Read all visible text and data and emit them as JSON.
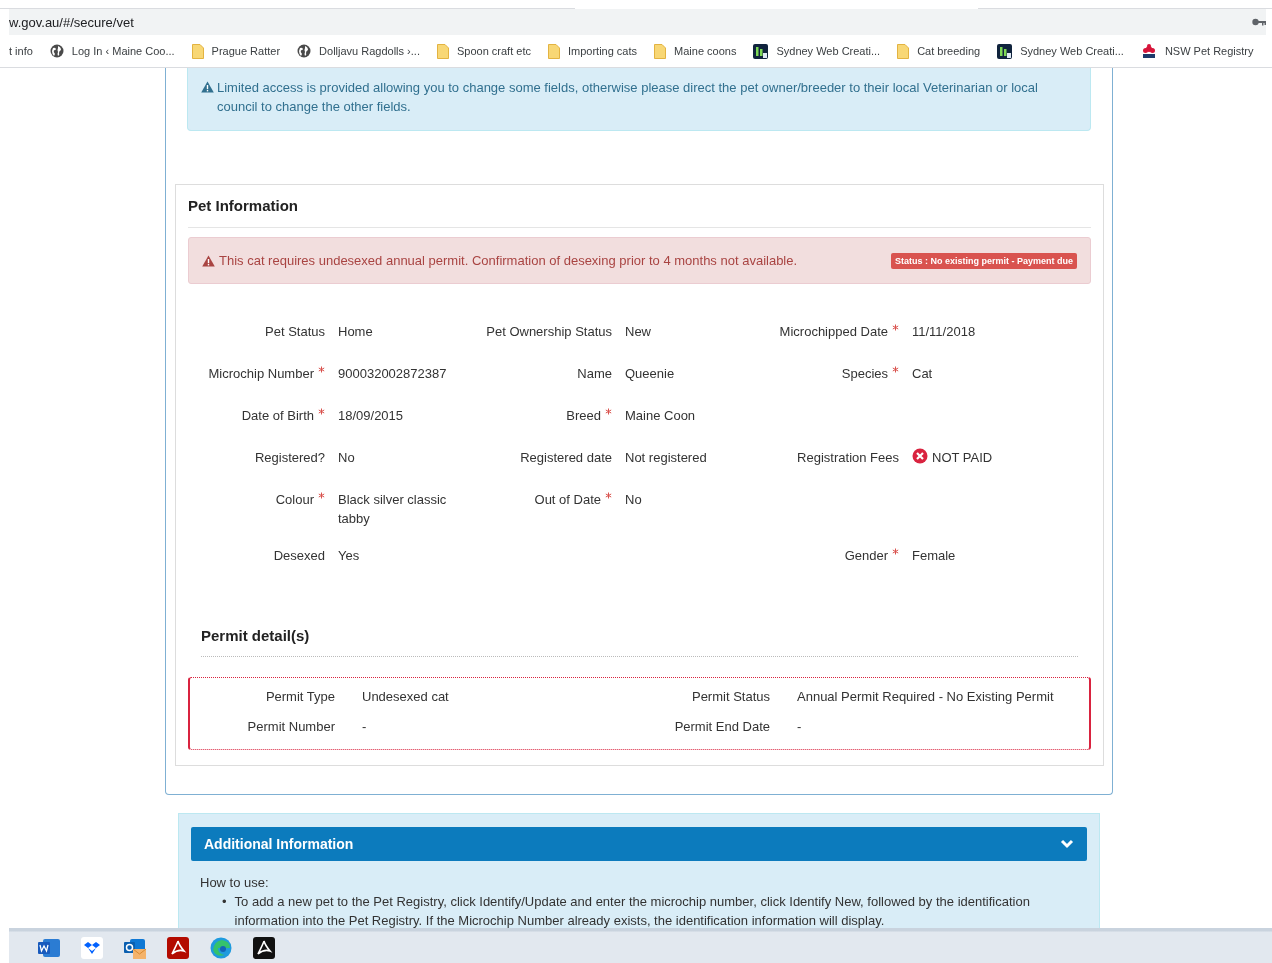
{
  "browser": {
    "url": "w.gov.au/#/secure/vet",
    "bookmarks": [
      {
        "label": "t info",
        "kind": "plain"
      },
      {
        "label": "Log In ‹ Maine Coo...",
        "kind": "site"
      },
      {
        "label": "Prague Ratter",
        "kind": "folder"
      },
      {
        "label": "Dolljavu Ragdolls ›...",
        "kind": "site"
      },
      {
        "label": "Spoon craft etc",
        "kind": "folder"
      },
      {
        "label": "Importing cats",
        "kind": "folder"
      },
      {
        "label": "Maine coons",
        "kind": "folder"
      },
      {
        "label": "Sydney Web Creati...",
        "kind": "app"
      },
      {
        "label": "Cat breeding",
        "kind": "folder"
      },
      {
        "label": "Sydney Web Creati...",
        "kind": "app"
      },
      {
        "label": "NSW Pet Registry",
        "kind": "registry"
      }
    ]
  },
  "notice": {
    "message": "Limited access is provided allowing you to change some fields, otherwise please direct the pet owner/breeder to their local Veterinarian or local council to change the other fields."
  },
  "pet_information": {
    "title": "Pet Information",
    "alert": {
      "message": "This cat requires undesexed annual permit. Confirmation of desexing prior to 4 months not available.",
      "badge": "Status : No existing permit - Payment due"
    },
    "rows": [
      [
        {
          "label": "Pet Status",
          "required": false,
          "value": "Home"
        },
        {
          "label": "Pet Ownership Status",
          "required": false,
          "value": "New"
        },
        {
          "label": "Microchipped Date",
          "required": true,
          "value": "11/11/2018"
        }
      ],
      [
        {
          "label": "Microchip Number",
          "required": true,
          "value": "900032002872387"
        },
        {
          "label": "Name",
          "required": false,
          "value": "Queenie"
        },
        {
          "label": "Species",
          "required": true,
          "value": "Cat"
        }
      ],
      [
        {
          "label": "Date of Birth",
          "required": true,
          "value": "18/09/2015"
        },
        {
          "label": "Breed",
          "required": true,
          "value": "Maine Coon"
        },
        null
      ],
      [
        {
          "label": "Registered?",
          "required": false,
          "value": "No"
        },
        {
          "label": "Registered date",
          "required": false,
          "value": "Not registered"
        },
        {
          "label": "Registration Fees",
          "required": false,
          "value": "NOT PAID",
          "kind": "unpaid"
        }
      ],
      [
        {
          "label": "Colour",
          "required": true,
          "value": "Black silver classic tabby"
        },
        {
          "label": "Out of Date",
          "required": true,
          "value": "No"
        },
        null
      ],
      [
        {
          "label": "Desexed",
          "required": false,
          "value": "Yes"
        },
        null,
        {
          "label": "Gender",
          "required": true,
          "value": "Female"
        }
      ]
    ]
  },
  "permit_details": {
    "title": "Permit detail(s)",
    "rows": [
      [
        {
          "label": "Permit Type",
          "value": "Undesexed cat"
        },
        {
          "label": "Permit Status",
          "value": "Annual Permit Required - No Existing Permit"
        }
      ],
      [
        {
          "label": "Permit Number",
          "value": "-"
        },
        {
          "label": "Permit End Date",
          "value": "-"
        }
      ]
    ]
  },
  "additional_information": {
    "title": "Additional Information",
    "expanded": true,
    "intro": "How to use:",
    "bullets": [
      {
        "marker": "•",
        "text": "To add a new pet to the Pet Registry, click Identify/Update and enter the microchip number, click Identify New, followed by the identification information into the Pet Registry. If the Microchip Number already exists, the identification information will display."
      }
    ]
  }
}
